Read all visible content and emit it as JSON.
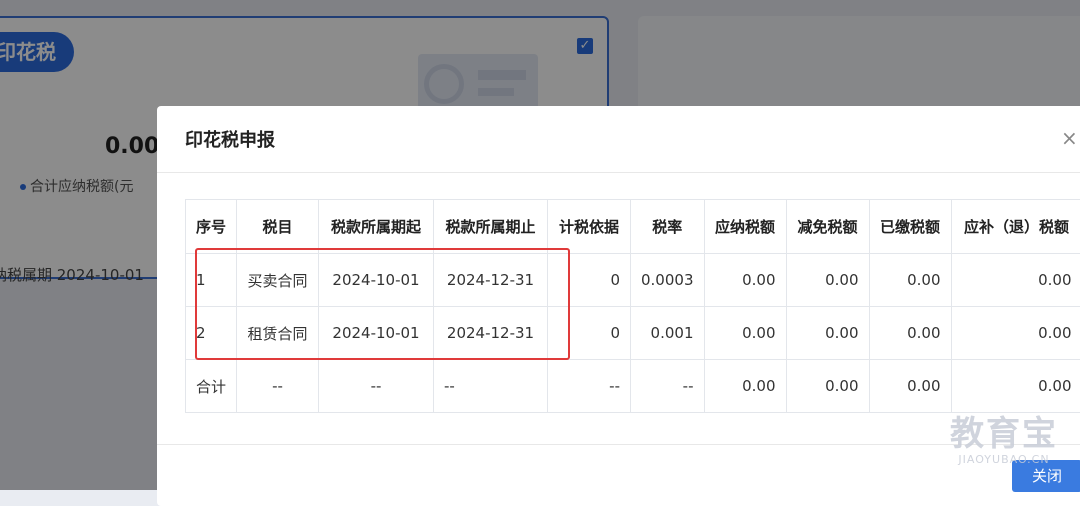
{
  "background": {
    "card_title": "印花税",
    "amount": "0.00",
    "amount_label": "合计应纳税额(元",
    "period_label": "纳税属期 2024-10-01",
    "checkbox_mark": "✓"
  },
  "modal": {
    "title": "印花税申报",
    "close_glyph": "×",
    "close_button_label": "关闭"
  },
  "table": {
    "headers": [
      "序号",
      "税目",
      "税款所属期起",
      "税款所属期止",
      "计税依据",
      "税率",
      "应纳税额",
      "减免税额",
      "已缴税额",
      "应补（退）税额"
    ],
    "rows": [
      [
        "1",
        "买卖合同",
        "2024-10-01",
        "2024-12-31",
        "0",
        "0.0003",
        "0.00",
        "0.00",
        "0.00",
        "0.00"
      ],
      [
        "2",
        "租赁合同",
        "2024-10-01",
        "2024-12-31",
        "0",
        "0.001",
        "0.00",
        "0.00",
        "0.00",
        "0.00"
      ]
    ],
    "total_row": [
      "合计",
      "--",
      "--",
      "--",
      "--",
      "--",
      "0.00",
      "0.00",
      "0.00",
      "0.00"
    ]
  },
  "watermark": {
    "line1": "教育宝",
    "line2": "JIAOYUBAO.CN"
  },
  "colors": {
    "accent": "#3a7be0",
    "highlight_border": "#e03a3a"
  }
}
